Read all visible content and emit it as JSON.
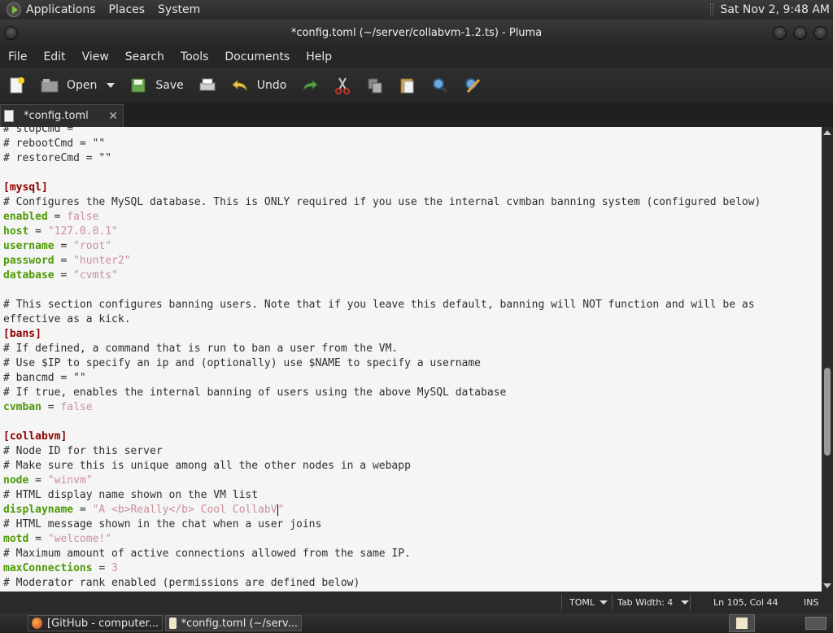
{
  "top_panel": {
    "menu": [
      "Applications",
      "Places",
      "System"
    ],
    "clock": "Sat Nov 2,  9:48 AM"
  },
  "window": {
    "title": "*config.toml (~/server/collabvm-1.2.ts) - Pluma"
  },
  "menubar": [
    "File",
    "Edit",
    "View",
    "Search",
    "Tools",
    "Documents",
    "Help"
  ],
  "toolbar": {
    "open_label": "Open",
    "save_label": "Save",
    "undo_label": "Undo"
  },
  "tab": {
    "label": "*config.toml"
  },
  "editor": {
    "lines": [
      [
        {
          "t": "c",
          "v": "# stopCmd = \"\""
        }
      ],
      [
        {
          "t": "c",
          "v": "# rebootCmd = \"\""
        }
      ],
      [
        {
          "t": "c",
          "v": "# restoreCmd = \"\""
        }
      ],
      [],
      [
        {
          "t": "sec",
          "v": "[mysql]"
        }
      ],
      [
        {
          "t": "c",
          "v": "# Configures the MySQL database. This is ONLY required if you use the internal cvmban banning system (configured below)"
        }
      ],
      [
        {
          "t": "k",
          "v": "enabled"
        },
        {
          "t": "c",
          "v": " = "
        },
        {
          "t": "s",
          "v": "false"
        }
      ],
      [
        {
          "t": "k",
          "v": "host"
        },
        {
          "t": "c",
          "v": " = "
        },
        {
          "t": "s",
          "v": "\"127.0.0.1\""
        }
      ],
      [
        {
          "t": "k",
          "v": "username"
        },
        {
          "t": "c",
          "v": " = "
        },
        {
          "t": "s",
          "v": "\"root\""
        }
      ],
      [
        {
          "t": "k",
          "v": "password"
        },
        {
          "t": "c",
          "v": " = "
        },
        {
          "t": "s",
          "v": "\"hunter2\""
        }
      ],
      [
        {
          "t": "k",
          "v": "database"
        },
        {
          "t": "c",
          "v": " = "
        },
        {
          "t": "s",
          "v": "\"cvmts\""
        }
      ],
      [],
      [
        {
          "t": "c",
          "v": "# This section configures banning users. Note that if you leave this default, banning will NOT function and will be as"
        }
      ],
      [
        {
          "t": "c",
          "v": "effective as a kick."
        }
      ],
      [
        {
          "t": "sec",
          "v": "[bans]"
        }
      ],
      [
        {
          "t": "c",
          "v": "# If defined, a command that is run to ban a user from the VM."
        }
      ],
      [
        {
          "t": "c",
          "v": "# Use $IP to specify an ip and (optionally) use $NAME to specify a username"
        }
      ],
      [
        {
          "t": "c",
          "v": "# bancmd = \"\""
        }
      ],
      [
        {
          "t": "c",
          "v": "# If true, enables the internal banning of users using the above MySQL database"
        }
      ],
      [
        {
          "t": "k",
          "v": "cvmban"
        },
        {
          "t": "c",
          "v": " = "
        },
        {
          "t": "s",
          "v": "false"
        }
      ],
      [],
      [
        {
          "t": "sec",
          "v": "[collabvm]"
        }
      ],
      [
        {
          "t": "c",
          "v": "# Node ID for this server"
        }
      ],
      [
        {
          "t": "c",
          "v": "# Make sure this is unique among all the other nodes in a webapp"
        }
      ],
      [
        {
          "t": "k",
          "v": "node"
        },
        {
          "t": "c",
          "v": " = "
        },
        {
          "t": "s",
          "v": "\"winvm\""
        }
      ],
      [
        {
          "t": "c",
          "v": "# HTML display name shown on the VM list"
        },
        {
          "t": "caret"
        }
      ],
      [
        {
          "t": "k",
          "v": "displayname"
        },
        {
          "t": "c",
          "v": " = "
        },
        {
          "t": "s",
          "v": "\"A <b>Really</b> Cool CollabV"
        },
        {
          "t": "caret"
        },
        {
          "t": "s",
          "v": "\""
        }
      ],
      [
        {
          "t": "c",
          "v": "# HTML message shown in the chat when a user joins"
        }
      ],
      [
        {
          "t": "k",
          "v": "motd"
        },
        {
          "t": "c",
          "v": " = "
        },
        {
          "t": "s",
          "v": "\"welcome!\""
        }
      ],
      [
        {
          "t": "c",
          "v": "# Maximum amount of active connections allowed from the same IP."
        }
      ],
      [
        {
          "t": "k",
          "v": "maxConnections"
        },
        {
          "t": "c",
          "v": " = "
        },
        {
          "t": "s",
          "v": "3"
        }
      ],
      [
        {
          "t": "c",
          "v": "# Moderator rank enabled (permissions are defined below)"
        }
      ]
    ]
  },
  "statusbar": {
    "language": "TOML",
    "tab_width": "Tab Width:  4",
    "position": "Ln 105, Col 44",
    "mode": "INS"
  },
  "taskbar": {
    "items": [
      "[GitHub - computer...",
      "*config.toml (~/serv..."
    ]
  },
  "colors": {
    "key": "#4e9a06",
    "string": "#cc8f9c",
    "section": "#8b0000",
    "editor_bg": "#f5f5f5"
  }
}
